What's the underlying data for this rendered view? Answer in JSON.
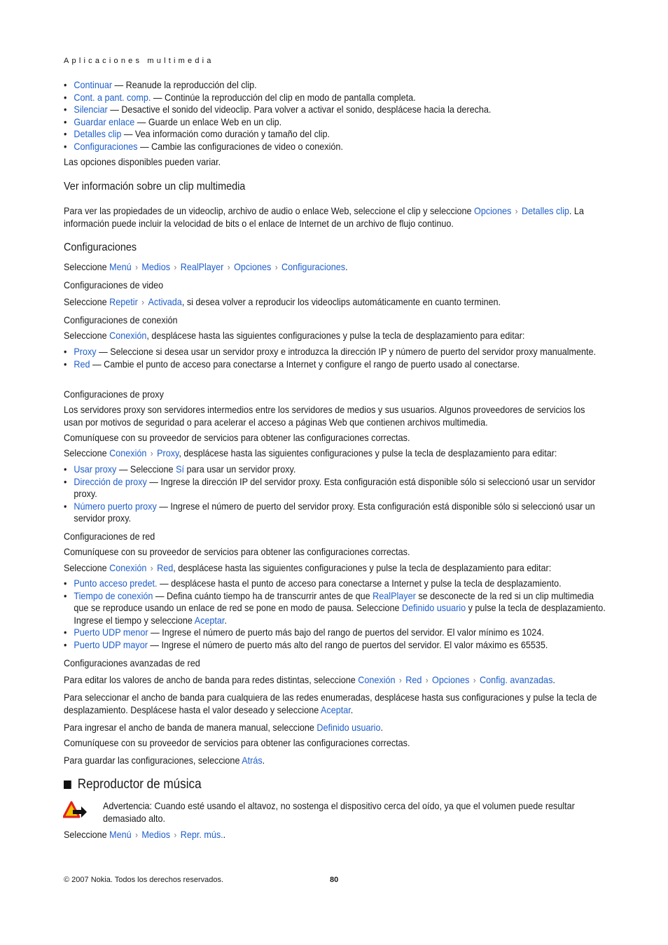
{
  "header": {
    "running_title": "Aplicaciones multimedia"
  },
  "options_list": [
    {
      "link": "Continuar",
      "text": " — Reanude la reproducción del clip."
    },
    {
      "link": "Cont. a pant. comp.",
      "text": " — Continúe la reproducción del clip en modo de pantalla completa."
    },
    {
      "link": "Silenciar",
      "text": " — Desactive el sonido del videoclip. Para volver a activar el sonido, desplácese hacia la derecha."
    },
    {
      "link": "Guardar enlace",
      "text": " — Guarde un enlace Web en un clip."
    },
    {
      "link": "Detalles clip",
      "text": " — Vea información como duración y tamaño del clip."
    },
    {
      "link": "Configuraciones",
      "text": " — Cambie las configuraciones de video o conexión."
    }
  ],
  "options_note": "Las opciones disponibles pueden variar.",
  "info_section": {
    "heading": "Ver información sobre un clip multimedia",
    "p_before": "Para ver las propiedades de un videoclip, archivo de audio o enlace Web, seleccione el clip y seleccione ",
    "link1": "Opciones",
    "link2": "Detalles clip",
    "p_after": ". La información puede incluir la velocidad de bits o el enlace de Internet de un archivo de flujo continuo."
  },
  "settings": {
    "heading": "Configuraciones",
    "select": "Seleccione ",
    "path": [
      "Menú",
      "Medios",
      "RealPlayer",
      "Opciones",
      "Configuraciones"
    ],
    "video": {
      "heading": "Configuraciones de video",
      "path": [
        "Repetir",
        "Activada"
      ],
      "after": ", si desea volver a reproducir los videoclips automáticamente en cuanto terminen."
    },
    "connection": {
      "heading": "Configuraciones de conexión",
      "link": "Conexión",
      "after": ", desplácese hasta las siguientes configuraciones y pulse la tecla de desplazamiento para editar:",
      "items": [
        {
          "link": "Proxy",
          "text": " — Seleccione si desea usar un servidor proxy e introduzca la dirección IP y número de puerto del servidor proxy manualmente."
        },
        {
          "link": "Red",
          "text": " — Cambie el punto de acceso para conectarse a Internet y configure el rango de puerto usado al conectarse."
        }
      ]
    },
    "proxy": {
      "heading": "Configuraciones de proxy",
      "p1": "Los servidores proxy son servidores intermedios entre los servidores de medios y sus usuarios. Algunos proveedores de servicios los usan por motivos de seguridad o para acelerar el acceso a páginas Web que contienen archivos multimedia.",
      "p2": "Comuníquese con su proveedor de servicios para obtener las configuraciones correctas.",
      "path": [
        "Conexión",
        "Proxy"
      ],
      "after": ", desplácese hasta las siguientes configuraciones y pulse la tecla de desplazamiento para editar:",
      "items": [
        {
          "link": "Usar proxy",
          "text1": " — Seleccione ",
          "link2": "Sí",
          "text2": " para usar un servidor proxy."
        },
        {
          "link": "Dirección de proxy",
          "text": " — Ingrese la dirección IP del servidor proxy. Esta configuración está disponible sólo si seleccionó usar un servidor proxy."
        },
        {
          "link": "Número puerto proxy",
          "text": " — Ingrese el número de puerto del servidor proxy. Esta configuración está disponible sólo si seleccionó usar un servidor proxy."
        }
      ]
    },
    "network": {
      "heading": "Configuraciones de red",
      "p1": "Comuníquese con su proveedor de servicios para obtener las configuraciones correctas.",
      "path": [
        "Conexión",
        "Red"
      ],
      "after": ", desplácese hasta las siguientes configuraciones y pulse la tecla de desplazamiento para editar:",
      "items": [
        {
          "link": "Punto acceso predet.",
          "text": " — desplácese hasta el punto de acceso para conectarse a Internet y pulse la tecla de desplazamiento."
        },
        {
          "link": "Tiempo de conexión",
          "t1": " — Defina cuánto tiempo ha de transcurrir antes de que ",
          "l2": "RealPlayer",
          "t2": " se desconecte de la red si un clip multimedia que se reproduce usando un enlace de red se pone en modo de pausa. Seleccione ",
          "l3": "Definido usuario",
          "t3": " y pulse la tecla de desplazamiento. Ingrese el tiempo y seleccione ",
          "l4": "Aceptar",
          "t4": "."
        },
        {
          "link": "Puerto UDP menor",
          "text": " — Ingrese el número de puerto más bajo del rango de puertos del servidor. El valor mínimo es 1024."
        },
        {
          "link": "Puerto UDP mayor",
          "text": " — Ingrese el número de puerto más alto del rango de puertos del servidor. El valor máximo es 65535."
        }
      ]
    },
    "advanced": {
      "heading": "Configuraciones avanzadas de red",
      "p1_before": "Para editar los valores de ancho de banda para redes distintas, seleccione ",
      "p1_path": [
        "Conexión",
        "Red",
        "Opciones",
        "Config. avanzadas"
      ],
      "p2_before": "Para seleccionar el ancho de banda para cualquiera de las redes enumeradas, desplácese hasta sus configuraciones y pulse la tecla de desplazamiento. Desplácese hasta el valor deseado y seleccione ",
      "p2_link": "Aceptar",
      "p3_before": "Para ingresar el ancho de banda de manera manual, seleccione ",
      "p3_link": "Definido usuario",
      "p4": "Comuníquese con su proveedor de servicios para obtener las configuraciones correctas.",
      "p5_before": "Para guardar las configuraciones, seleccione ",
      "p5_link": "Atrás",
      "dot": "."
    }
  },
  "music": {
    "heading": "Reproductor de música",
    "warning_label": "Advertencia:",
    "warning_text": " Cuando esté usando el altavoz, no sostenga el dispositivo cerca del oído, ya que el volumen puede resultar demasiado alto.",
    "path": [
      "Menú",
      "Medios",
      "Repr. mús."
    ]
  },
  "footer": {
    "copyright": "© 2007 Nokia. Todos los derechos reservados.",
    "page_number": "80"
  },
  "sep_glyph": "›"
}
